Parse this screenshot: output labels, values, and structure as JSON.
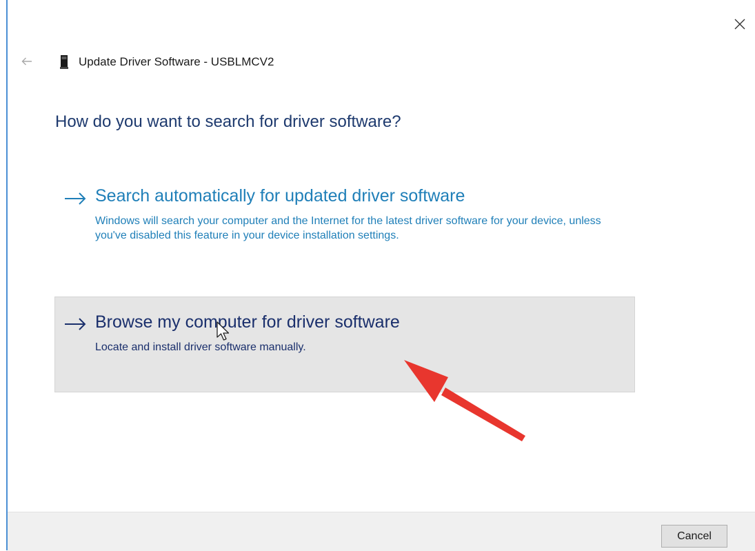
{
  "window": {
    "title": "Update Driver Software - USBLMCV2",
    "close_icon": "close-icon",
    "back_icon": "back-arrow-icon",
    "device_icon": "usb-device-icon"
  },
  "question": "How do you want to search for driver software?",
  "options": [
    {
      "icon": "arrow-right-icon",
      "title": "Search automatically for updated driver software",
      "description": "Windows will search your computer and the Internet for the latest driver software for your device, unless you've disabled this feature in your device installation settings.",
      "color": "#1f7fb8"
    },
    {
      "icon": "arrow-right-icon",
      "title": "Browse my computer for driver software",
      "description": "Locate and install driver software manually.",
      "color": "#1a2f6c",
      "state": "hovered"
    }
  ],
  "footer": {
    "cancel_label": "Cancel"
  },
  "annotation": {
    "icon": "red-arrow-annotation",
    "color": "#e8362e"
  }
}
